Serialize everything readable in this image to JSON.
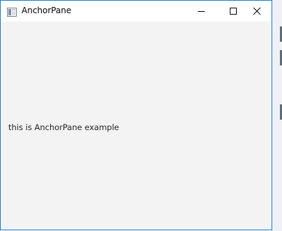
{
  "window": {
    "title": "AnchorPane",
    "icon": "java-app-icon",
    "controls": {
      "minimize_icon": "minimize-icon",
      "maximize_icon": "maximize-icon",
      "close_icon": "close-icon"
    },
    "accent_color": "#1979ca"
  },
  "content": {
    "label": "this is AnchorPane example",
    "background": "#f3f3f3"
  }
}
